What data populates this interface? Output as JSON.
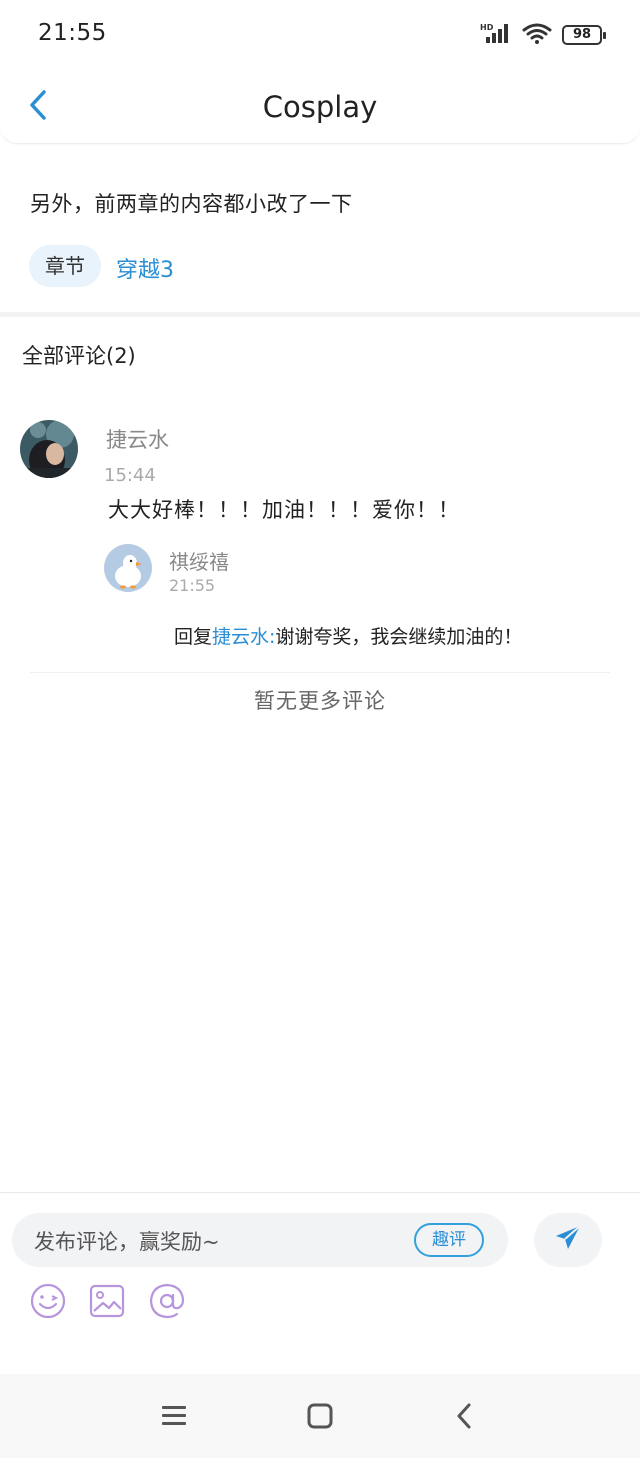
{
  "status_bar": {
    "time": "21:55",
    "network_badge": "HD",
    "battery": "98"
  },
  "header": {
    "title": "Cosplay",
    "back_icon": "chevron-left-icon"
  },
  "post": {
    "text": "另外，前两章的内容都小改了一下",
    "tag_label": "章节",
    "chapter_link": "穿越3"
  },
  "comments": {
    "title": "全部评论(2)",
    "items": [
      {
        "name": "捷云水",
        "time": "15:44",
        "text": "大大好棒！！！加油！！！爱你！！",
        "replies": [
          {
            "name": "祺绥禧",
            "time": "21:55",
            "reply_prefix": "回复",
            "mention": "捷云水:",
            "text": "谢谢夸奖，我会继续加油的！"
          }
        ]
      }
    ],
    "no_more": "暂无更多评论"
  },
  "composer": {
    "placeholder": "发布评论，赢奖励~",
    "fun_label": "趣评",
    "send_icon": "send-icon",
    "tools": [
      "emoji-icon",
      "image-icon",
      "at-icon"
    ]
  },
  "nav_bar": {
    "items": [
      "menu-icon",
      "home-icon",
      "back-icon"
    ]
  },
  "colors": {
    "accent": "#2a8ed5",
    "tag_bg": "#e8f3fb",
    "tool_icon": "#b795dc",
    "input_bg": "#f2f3f5"
  }
}
